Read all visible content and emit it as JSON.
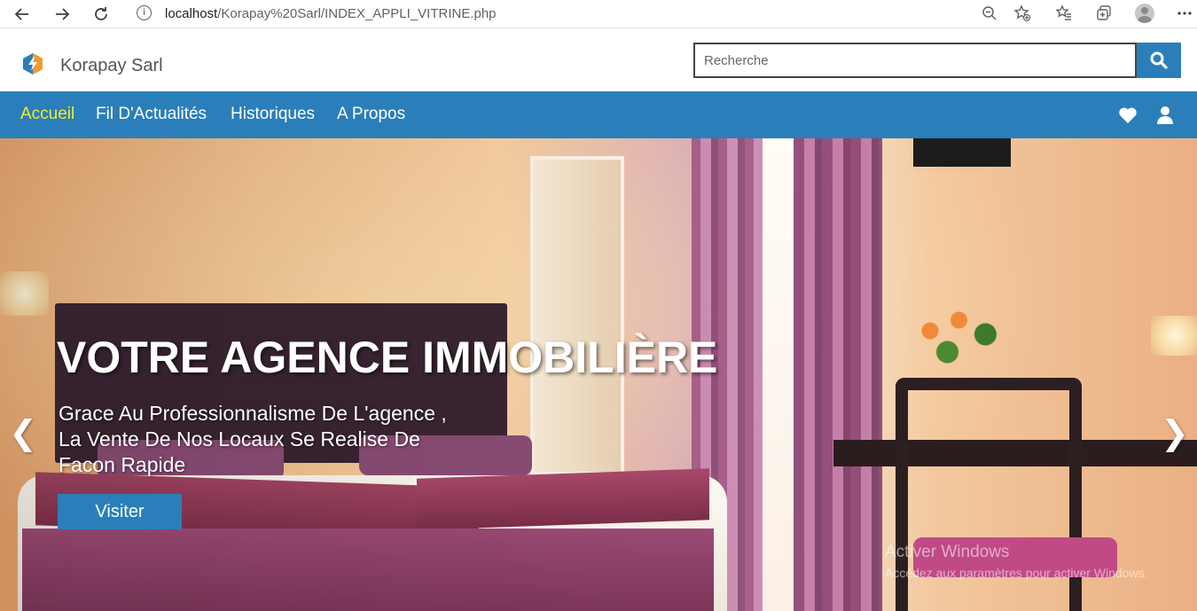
{
  "browser": {
    "url_host": "localhost",
    "url_path": "/Korapay%20Sarl/INDEX_APPLI_VITRINE.php",
    "info_symbol": "i"
  },
  "header": {
    "brand": "Korapay Sarl",
    "search_placeholder": "Recherche"
  },
  "nav": {
    "items": [
      {
        "label": "Accueil",
        "active": true
      },
      {
        "label": "Fil D'Actualités",
        "active": false
      },
      {
        "label": "Historiques",
        "active": false
      },
      {
        "label": "A Propos",
        "active": false
      }
    ],
    "icons": [
      "heart-icon",
      "user-icon"
    ]
  },
  "hero": {
    "title": "VOTRE AGENCE IMMOBILIÈRE",
    "subtitle_lines": [
      "Grace Au Professionnalisme De L'agence ,",
      "La Vente De Nos Locaux Se Realise De",
      "Facon Rapide"
    ],
    "button_label": "Visiter",
    "prev_arrow": "❮",
    "next_arrow": "❯"
  },
  "os_watermark": {
    "title": "Activer Windows",
    "subtitle": "Accédez aux paramètres pour activer Windows."
  },
  "colors": {
    "primary": "#2a7fba",
    "nav_active": "#f5ec2a",
    "brand_text": "#555555"
  }
}
